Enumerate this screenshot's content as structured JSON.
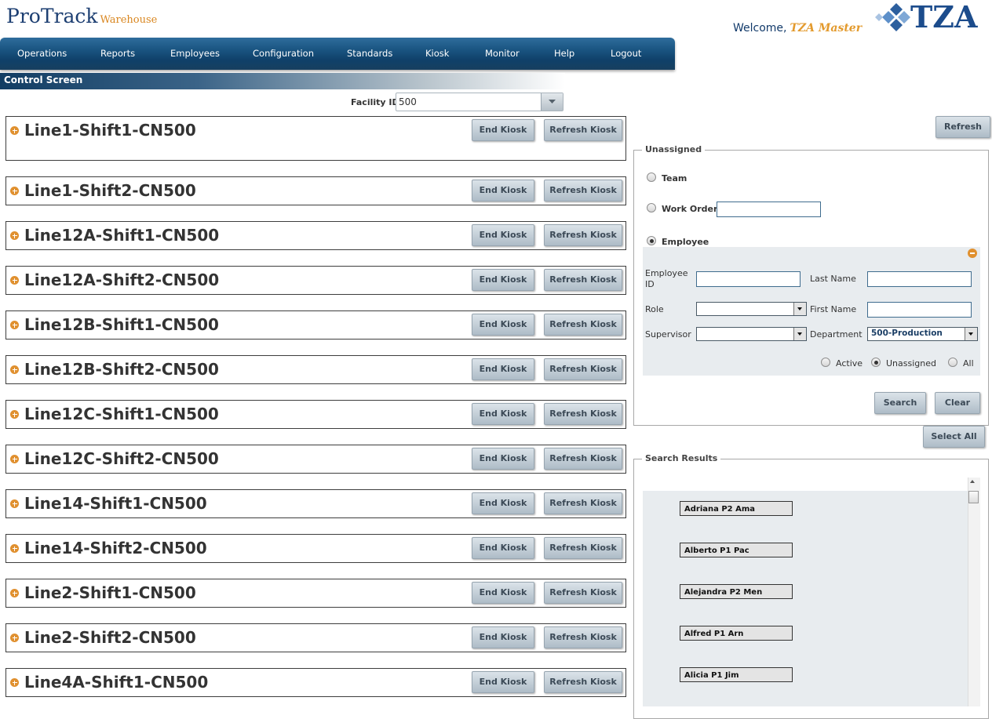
{
  "header": {
    "logo_main": "ProTrack",
    "logo_sub": "Warehouse",
    "welcome_label": "Welcome,",
    "welcome_user": "TZA Master",
    "brand": "TZA"
  },
  "nav": {
    "items": [
      "Operations",
      "Reports",
      "Employees",
      "Configuration",
      "Standards",
      "Kiosk",
      "Monitor",
      "Help",
      "Logout"
    ]
  },
  "page_title": "Control Screen",
  "facility": {
    "label": "Facility ID",
    "value": "500"
  },
  "lines": {
    "end_label": "End Kiosk",
    "refresh_label": "Refresh Kiosk",
    "items": [
      "Line1-Shift1-CN500",
      "Line1-Shift2-CN500",
      "Line12A-Shift1-CN500",
      "Line12A-Shift2-CN500",
      "Line12B-Shift1-CN500",
      "Line12B-Shift2-CN500",
      "Line12C-Shift1-CN500",
      "Line12C-Shift2-CN500",
      "Line14-Shift1-CN500",
      "Line14-Shift2-CN500",
      "Line2-Shift1-CN500",
      "Line2-Shift2-CN500",
      "Line4A-Shift1-CN500"
    ]
  },
  "right": {
    "refresh_label": "Refresh",
    "unassigned_legend": "Unassigned",
    "radio_team": "Team",
    "radio_work_order": "Work Order",
    "radio_employee": "Employee",
    "selected_radio": "Employee",
    "work_order_value": "",
    "filters": {
      "employee_id_label": "Employee ID",
      "last_name_label": "Last Name",
      "role_label": "Role",
      "first_name_label": "First Name",
      "supervisor_label": "Supervisor",
      "department_label": "Department",
      "department_value": "500-Production",
      "status_active": "Active",
      "status_unassigned": "Unassigned",
      "status_all": "All",
      "selected_status": "Unassigned"
    },
    "search_label": "Search",
    "clear_label": "Clear",
    "select_all_label": "Select All",
    "results_legend": "Search Results",
    "results": [
      "Adriana P2 Ama",
      "Alberto P1 Pac",
      "Alejandra P2 Men",
      "Alfred P1 Arn",
      "Alicia P1 Jim"
    ]
  }
}
